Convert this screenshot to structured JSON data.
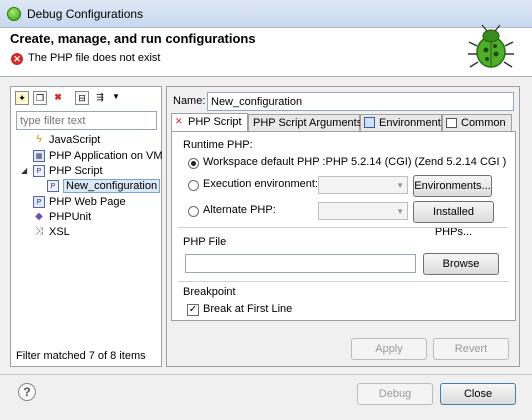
{
  "window": {
    "title": "Debug Configurations"
  },
  "header": {
    "heading": "Create, manage, and run configurations",
    "error_message": "The PHP file does not exist"
  },
  "left": {
    "filter_placeholder": "type filter text",
    "tree": [
      {
        "label": "JavaScript",
        "icon": "javascript-icon"
      },
      {
        "label": "PHP Application on VM",
        "icon": "php-app-icon"
      },
      {
        "label": "PHP Script",
        "icon": "php-script-icon",
        "expanded": true
      },
      {
        "label": "New_configuration",
        "icon": "php-config-icon",
        "selected": true
      },
      {
        "label": "PHP Web Page",
        "icon": "php-web-icon"
      },
      {
        "label": "PHPUnit",
        "icon": "phpunit-icon"
      },
      {
        "label": "XSL",
        "icon": "xsl-icon"
      }
    ],
    "status": "Filter matched 7 of 8 items"
  },
  "right": {
    "name_label": "Name:",
    "name_value": "New_configuration",
    "tabs": [
      {
        "label": "PHP Script"
      },
      {
        "label": "PHP Script Arguments"
      },
      {
        "label": "Environment"
      },
      {
        "label": "Common"
      }
    ],
    "runtime": {
      "title": "Runtime PHP:",
      "workspace_label": "Workspace default PHP :PHP 5.2.14 (CGI) (Zend 5.2.14 CGI )",
      "execution_label": "Execution environment:",
      "environments_button": "Environments...",
      "alternate_label": "Alternate PHP:",
      "installed_button": "Installed PHPs..."
    },
    "php_file": {
      "title": "PHP File",
      "value": "",
      "browse_button": "Browse"
    },
    "breakpoint": {
      "title": "Breakpoint",
      "break_first_label": "Break at First Line"
    },
    "apply_button": "Apply",
    "revert_button": "Revert"
  },
  "footer": {
    "help_glyph": "?",
    "debug_button": "Debug",
    "close_button": "Close"
  }
}
